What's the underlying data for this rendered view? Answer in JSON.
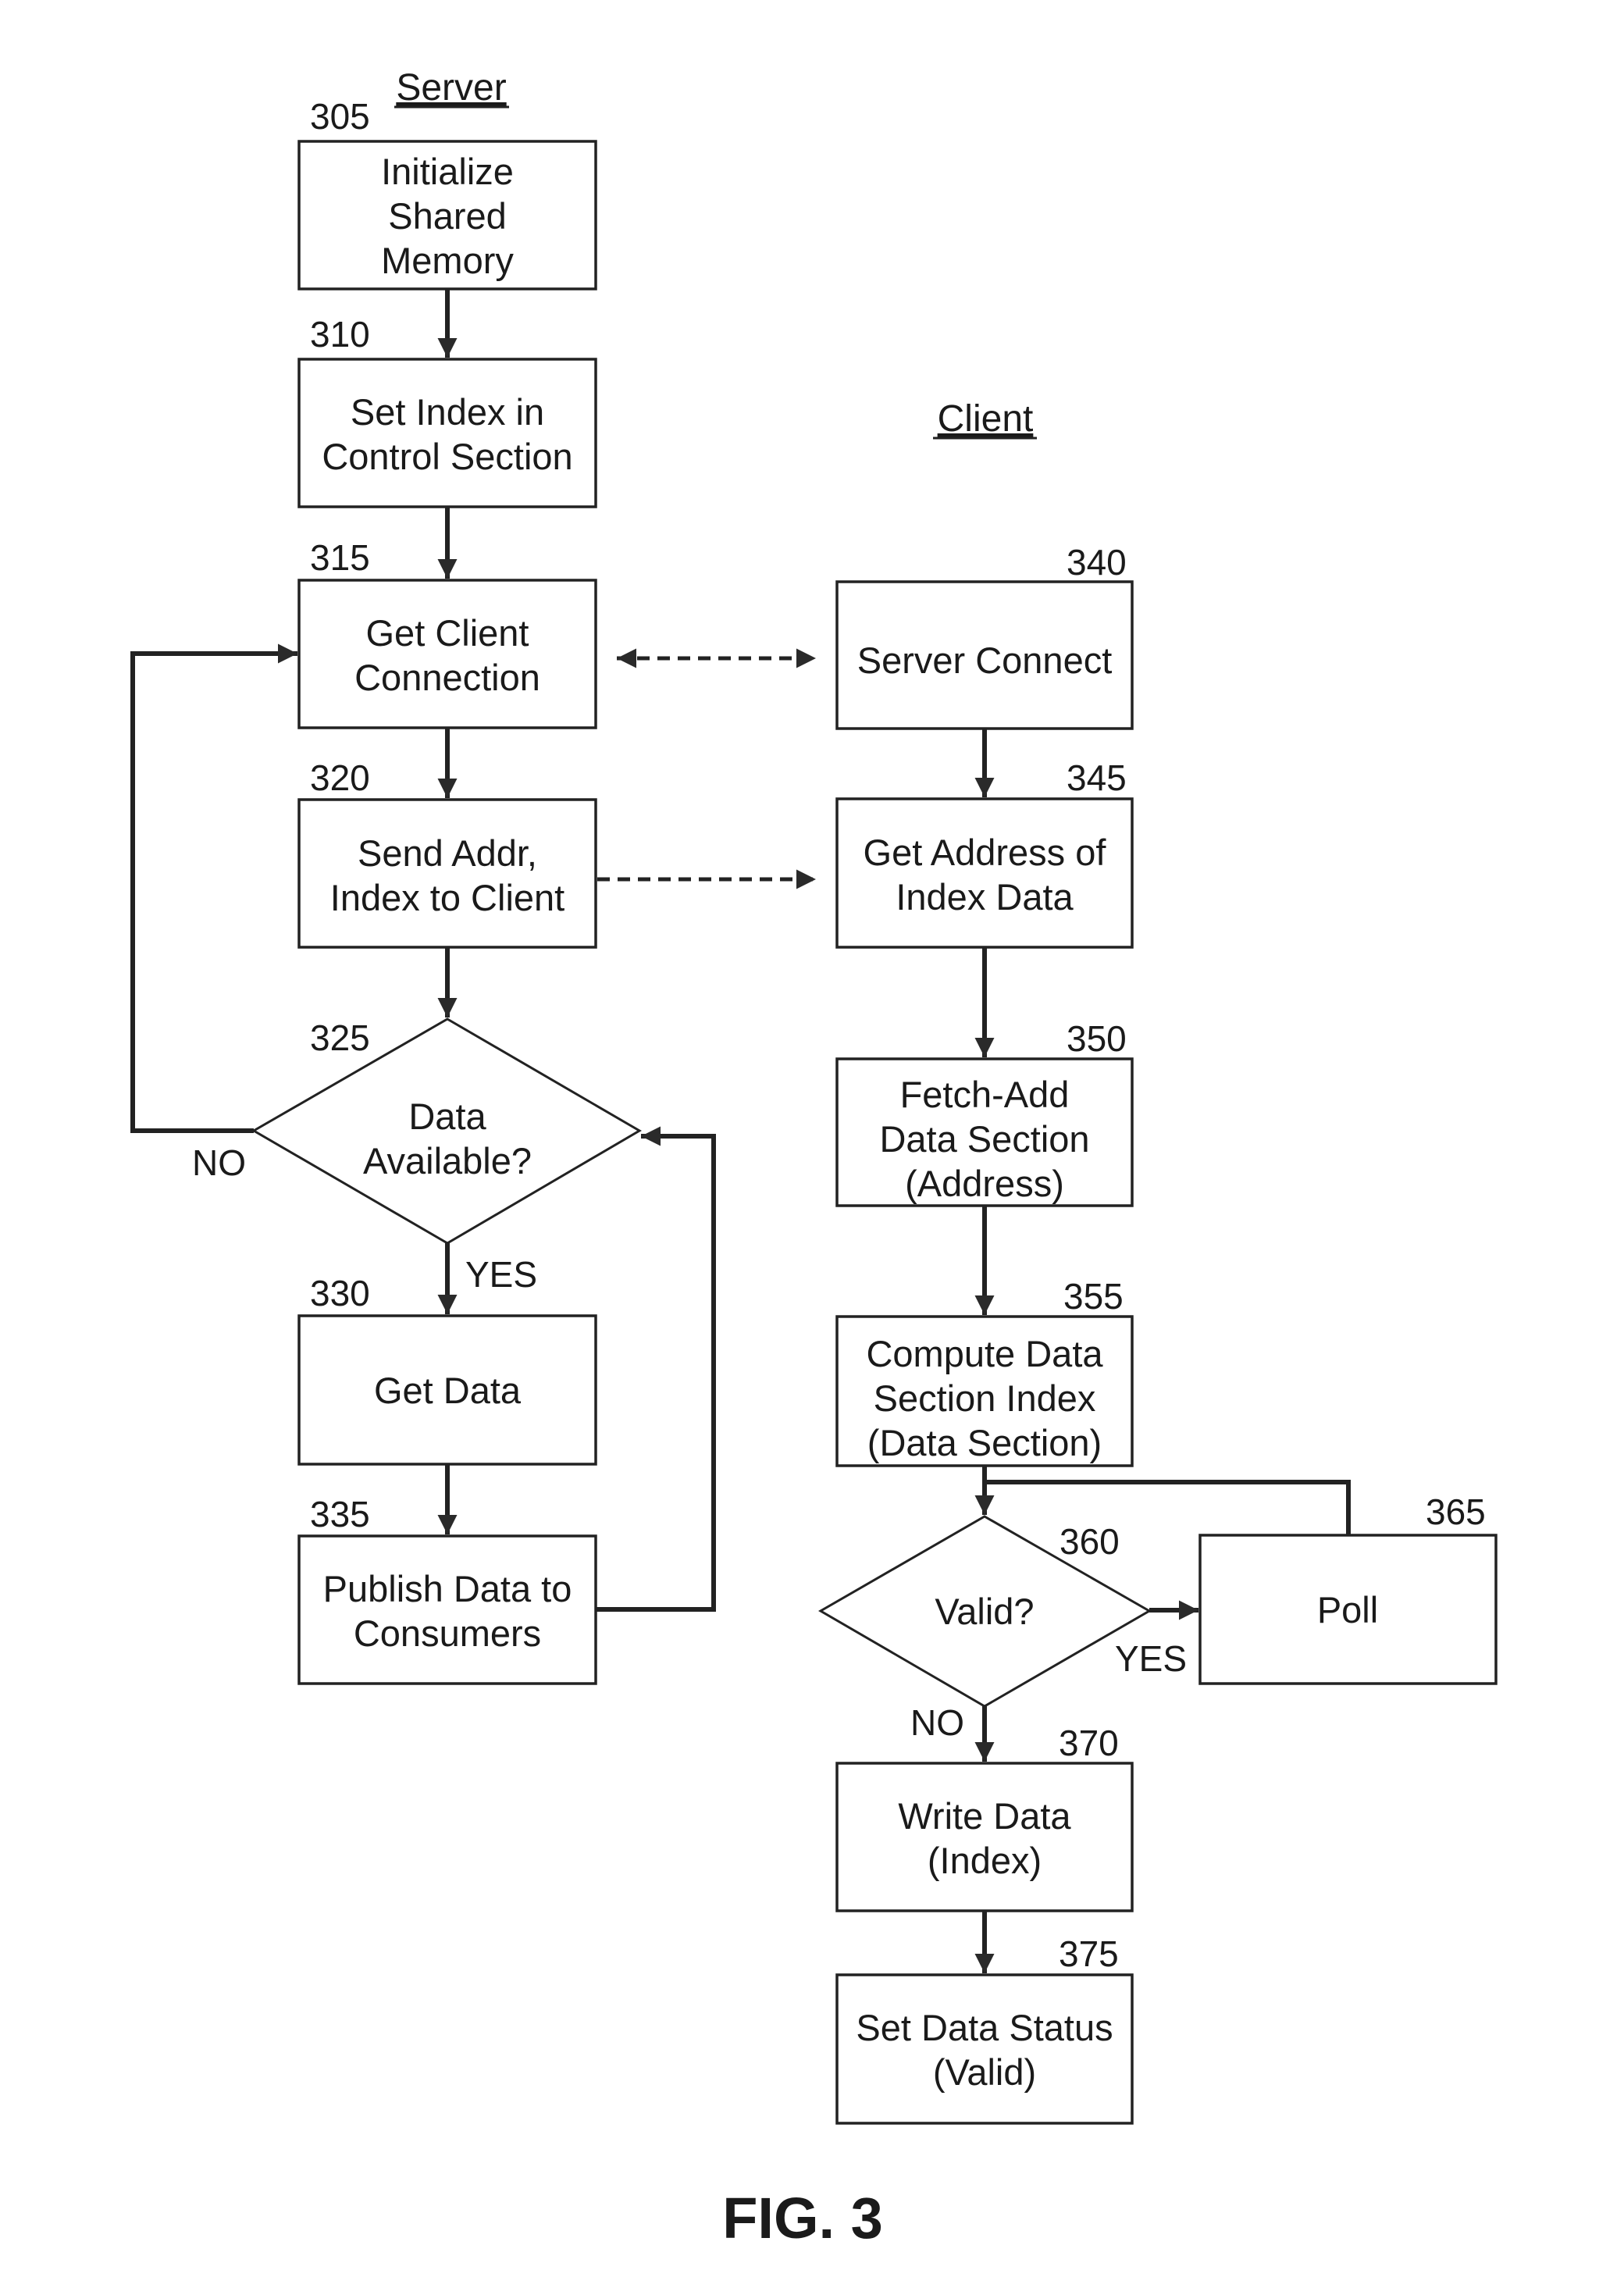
{
  "figure_label": "FIG. 3",
  "lanes": {
    "server": "Server",
    "client": "Client"
  },
  "steps": {
    "s305": {
      "ref": "305",
      "lines": [
        "Initialize",
        "Shared",
        "Memory"
      ]
    },
    "s310": {
      "ref": "310",
      "lines": [
        "Set Index in",
        "Control Section"
      ]
    },
    "s315": {
      "ref": "315",
      "lines": [
        "Get Client",
        "Connection"
      ]
    },
    "s320": {
      "ref": "320",
      "lines": [
        "Send Addr,",
        "Index to Client"
      ]
    },
    "s325": {
      "ref": "325",
      "lines": [
        "Data",
        "Available?"
      ],
      "no_label": "NO",
      "yes_label": "YES"
    },
    "s330": {
      "ref": "330",
      "lines": [
        "Get Data"
      ]
    },
    "s335": {
      "ref": "335",
      "lines": [
        "Publish Data to",
        "Consumers"
      ]
    },
    "s340": {
      "ref": "340",
      "lines": [
        "Server Connect"
      ]
    },
    "s345": {
      "ref": "345",
      "lines": [
        "Get Address of",
        "Index Data"
      ]
    },
    "s350": {
      "ref": "350",
      "lines": [
        "Fetch-Add",
        "Data Section",
        "(Address)"
      ]
    },
    "s355": {
      "ref": "355",
      "lines": [
        "Compute Data",
        "Section Index",
        "(Data Section)"
      ]
    },
    "s360": {
      "ref": "360",
      "lines": [
        "Valid?"
      ],
      "yes_label": "YES",
      "no_label": "NO"
    },
    "s365": {
      "ref": "365",
      "lines": [
        "Poll"
      ]
    },
    "s370": {
      "ref": "370",
      "lines": [
        "Write Data",
        "(Index)"
      ]
    },
    "s375": {
      "ref": "375",
      "lines": [
        "Set Data Status",
        "(Valid)"
      ]
    }
  }
}
